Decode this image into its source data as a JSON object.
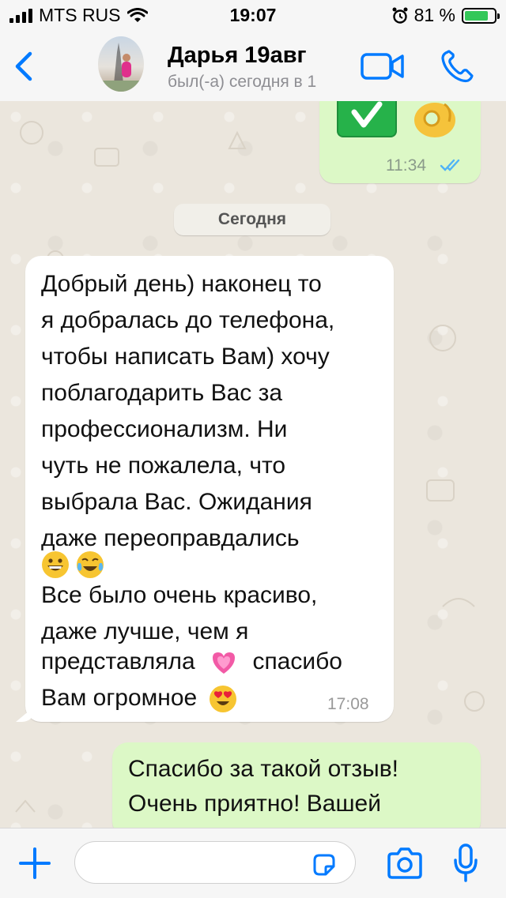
{
  "status_bar": {
    "carrier": "MTS RUS",
    "time": "19:07",
    "battery_percent": "81 %",
    "battery_level": 0.81
  },
  "header": {
    "contact_name": "Дарья 19авг",
    "contact_status": "был(-а) сегодня в 1"
  },
  "chat": {
    "top_message": {
      "time": "11:34",
      "status": "read"
    },
    "date_separator": "Сегодня",
    "incoming": {
      "lines": [
        "Добрый день) наконец то",
        "я добралась до телефона,",
        "чтобы написать Вам) хочу",
        "поблагодарить Вас за",
        "профессионализм. Ни",
        "чуть не пожалела, что",
        "выбрала Вас. Ожидания",
        "даже переоправдались",
        "",
        "Все было очень красиво,",
        "даже лучше, чем я",
        "представляла",
        "спасибо",
        "Вам огромное"
      ],
      "time": "17:08"
    },
    "outgoing_partial": {
      "lines": [
        "Спасибо за такой отзыв!",
        "Очень приятно! Вашей"
      ]
    }
  },
  "colors": {
    "accent": "#007aff",
    "outgoing_bubble": "#dcf8c6",
    "incoming_bubble": "#ffffff",
    "read_ticks": "#4fb3f6"
  }
}
